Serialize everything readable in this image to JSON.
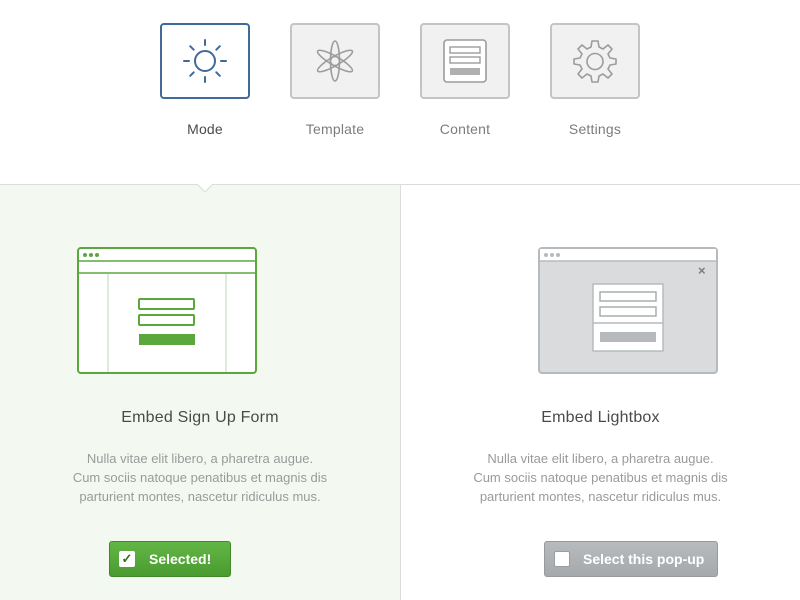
{
  "steps": [
    {
      "label": "Mode",
      "icon": "sun-icon",
      "active": true
    },
    {
      "label": "Template",
      "icon": "flower-icon",
      "active": false
    },
    {
      "label": "Content",
      "icon": "document-icon",
      "active": false
    },
    {
      "label": "Settings",
      "icon": "gear-icon",
      "active": false
    }
  ],
  "options": {
    "embed": {
      "title": "Embed Sign Up Form",
      "desc": [
        "Nulla vitae elit libero, a pharetra augue.",
        "Cum sociis natoque penatibus et magnis dis",
        "parturient montes, nascetur ridiculus mus."
      ],
      "button_label": "Selected!",
      "checkbox_mark": "✓",
      "selected": true
    },
    "lightbox": {
      "title": "Embed Lightbox",
      "desc": [
        "Nulla vitae elit libero, a pharetra augue.",
        "Cum sociis natoque penatibus et magnis dis",
        "parturient montes, nascetur ridiculus mus."
      ],
      "button_label": "Select this pop-up",
      "close_glyph": "×",
      "selected": false
    }
  },
  "colors": {
    "accent_blue": "#3f6a9a",
    "accent_green": "#5aa83c",
    "selected_panel_bg": "#f3f9f1",
    "inactive_gray": "#a9adaf"
  }
}
